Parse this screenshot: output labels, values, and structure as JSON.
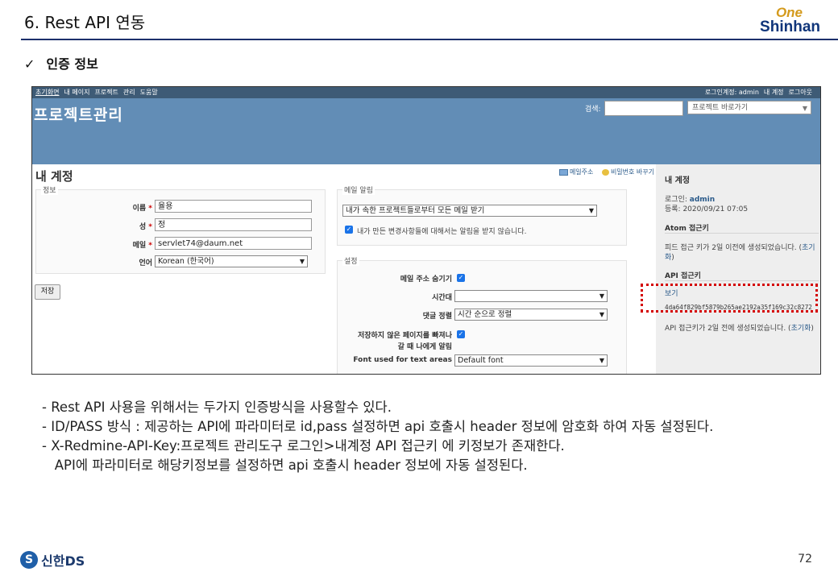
{
  "slide": {
    "title": "6. Rest API 연동",
    "logo_top": "One",
    "logo_bottom": "Shinhan",
    "heading_mark": "✓",
    "heading": "인증 정보",
    "bullets": [
      "- Rest API 사용을 위해서는 두가지 인증방식을 사용할수 있다.",
      "- ID/PASS 방식 : 제공하는 API에 파라미터로 id,pass 설정하면 api 호출시 header 정보에 암호화 하여 자동 설정된다.",
      "- X-Redmine-API-Key:프로젝트 관리도구 로그인>내계정 API 접근키 에 키정보가 존재한다.",
      "   API에 파라미터로 해당키정보를 설정하면 api 호출시 header 정보에 자동 설정된다."
    ],
    "footer_logo_mark": "S",
    "footer_logo": "신한DS",
    "page_number": "72"
  },
  "screenshot": {
    "topbar": {
      "links": [
        "초기화면",
        "내 페이지",
        "프로젝트",
        "관리",
        "도움말"
      ],
      "logged_in": "로그인계정: admin",
      "my_account": "내 계정",
      "logout": "로그아웃"
    },
    "header": {
      "title": "프로젝트관리",
      "search_label": "검색:",
      "jump_placeholder": "프로젝트 바로가기"
    },
    "page_title": "내 계정",
    "actions": {
      "email": "메일주소",
      "password": "비밀번호 바꾸기"
    },
    "info": {
      "legend": "정보",
      "firstname_label": "이름",
      "firstname_value": "율용",
      "lastname_label": "성",
      "lastname_value": "정",
      "mail_label": "메일",
      "mail_value": "servlet74@daum.net",
      "lang_label": "언어",
      "lang_value": "Korean (한국어)",
      "required_mark": "*"
    },
    "mail_notification": {
      "legend": "메일 알림",
      "select_value": "내가 속한 프로젝트들로부터 모든 메일 받기",
      "checkbox_label": "내가 만든 변경사항들에 대해서는 알림을 받지 않습니다."
    },
    "prefs": {
      "legend": "설정",
      "hide_mail_label": "메일 주소 숨기기",
      "timezone_label": "시간대",
      "timezone_value": "",
      "comments_label": "댓글 정렬",
      "comments_value": "시간 순으로 정렬",
      "warn_label_1": "저장하지 않은 페이지를 빠져나",
      "warn_label_2": "갈 때 나에게 알림",
      "font_label": "Font used for text areas",
      "font_value": "Default font"
    },
    "save_button": "저장",
    "sidebar": {
      "title": "내 계정",
      "login_label": "로그인:",
      "login_value": "admin",
      "created": "등록: 2020/09/21 07:05",
      "atom_title": "Atom 접근키",
      "atom_text_1": "피드 접근 키가 2일 이전에 생성되었습니다. (",
      "atom_reset_1": "초기",
      "atom_reset_2": "화",
      "atom_text_2": ")",
      "api_title": "API 접근키",
      "api_show": "보기",
      "api_key": "4da64f829bf5879b265ae2192a35f169c32c8272",
      "api_text": "API 접근키가 2일 전에 생성되었습니다. (",
      "api_reset": "초기화",
      "api_text_end": ")"
    },
    "colors": {
      "header": "#628db6",
      "topbar": "#3e5b76",
      "highlight": "#d40000"
    }
  }
}
